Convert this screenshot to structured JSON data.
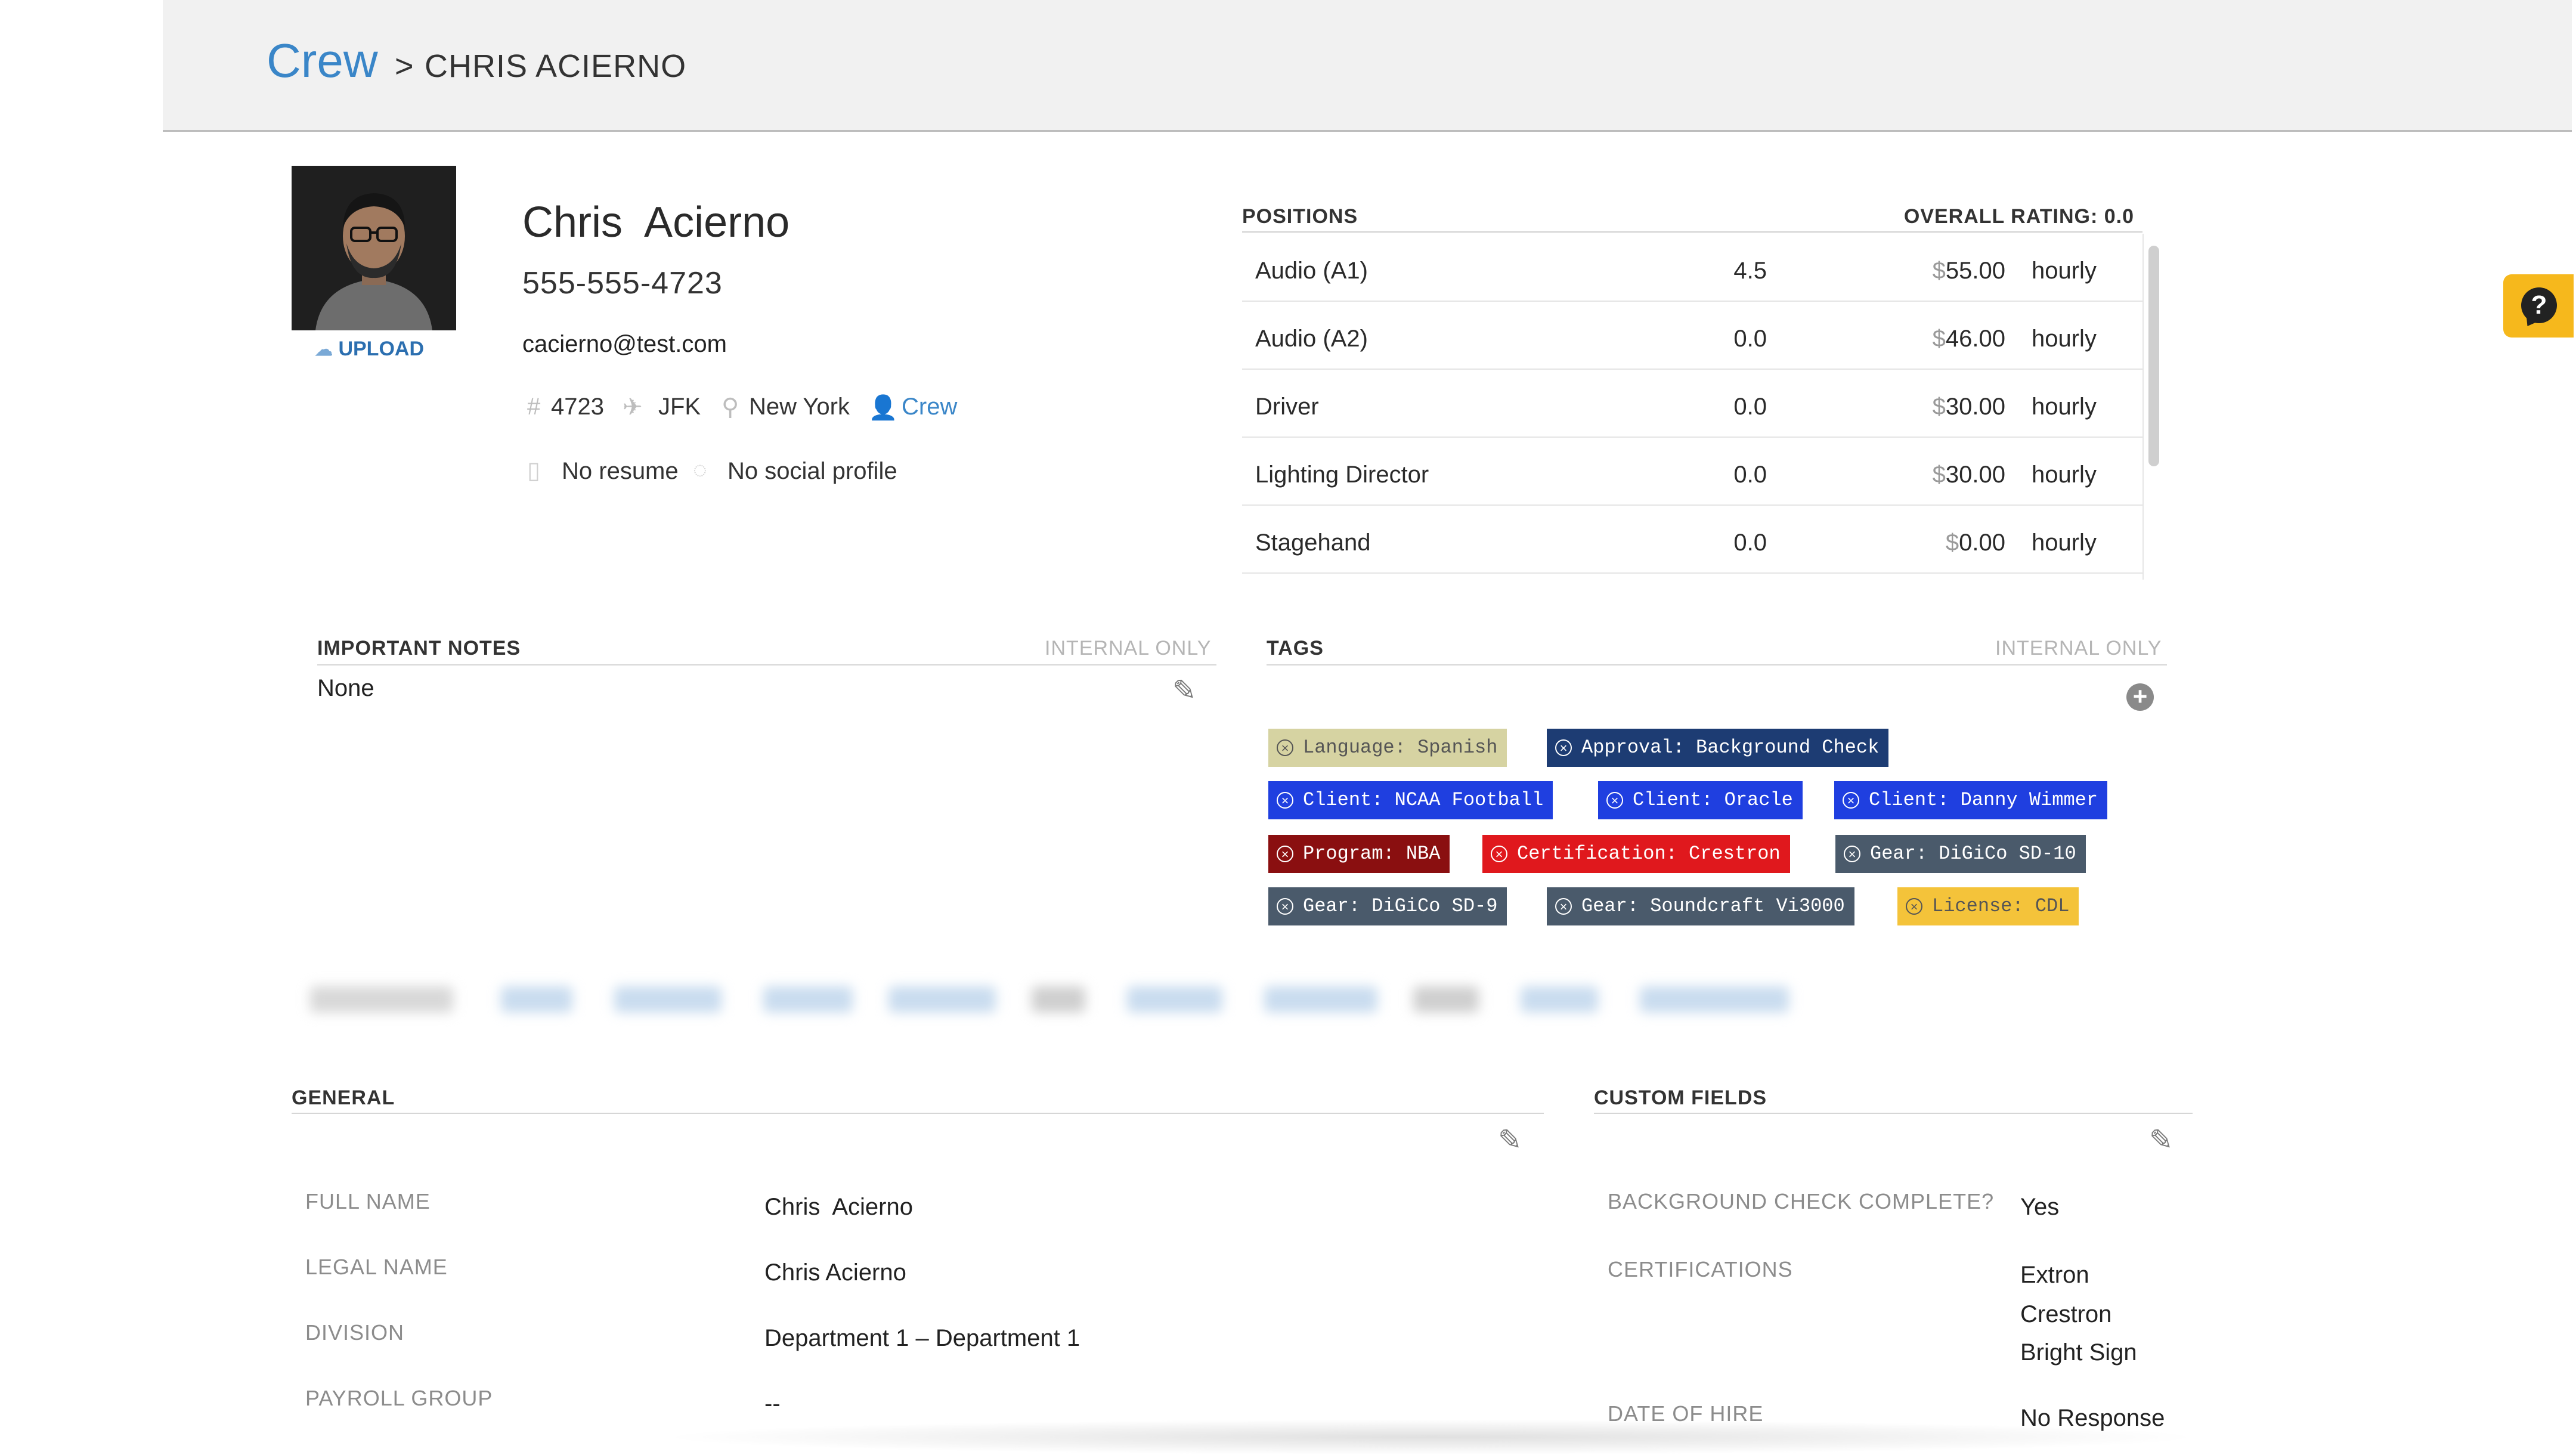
{
  "header": {
    "breadcrumb_root": "Crew",
    "breadcrumb_sep": ">",
    "breadcrumb_current": "CHRIS ACIERNO"
  },
  "help": {
    "icon": "help-chat-icon",
    "label": "?"
  },
  "profile": {
    "upload_label": "UPLOAD",
    "name": "Chris  Acierno",
    "phone": "555-555-4723",
    "email": "cacierno@test.com",
    "id_number": "4723",
    "airport": "JFK",
    "location": "New York",
    "group": "Crew",
    "resume": "No resume",
    "social": "No social profile"
  },
  "positions": {
    "title": "POSITIONS",
    "overall_rating": "OVERALL RATING: 0.0",
    "rows": [
      {
        "name": "Audio (A1)",
        "rating": "4.5",
        "pay": "55.00",
        "unit": "hourly"
      },
      {
        "name": "Audio (A2)",
        "rating": "0.0",
        "pay": "46.00",
        "unit": "hourly"
      },
      {
        "name": "Driver",
        "rating": "0.0",
        "pay": "30.00",
        "unit": "hourly"
      },
      {
        "name": "Lighting Director",
        "rating": "0.0",
        "pay": "30.00",
        "unit": "hourly"
      },
      {
        "name": "Stagehand",
        "rating": "0.0",
        "pay": "0.00",
        "unit": "hourly"
      }
    ],
    "currency_symbol": "$"
  },
  "notes": {
    "title": "IMPORTANT NOTES",
    "internal": "INTERNAL ONLY",
    "value": "None"
  },
  "tags": {
    "title": "TAGS",
    "internal": "INTERNAL ONLY",
    "items": [
      {
        "label": "Language: Spanish",
        "bg": "#d6d3a2",
        "fg": "#555555"
      },
      {
        "label": "Approval: Background Check",
        "bg": "#1d3c73",
        "fg": "#ffffff"
      },
      {
        "label": "Client: NCAA Football",
        "bg": "#1f3fe0",
        "fg": "#ffffff"
      },
      {
        "label": "Client: Oracle",
        "bg": "#1f3fe0",
        "fg": "#ffffff"
      },
      {
        "label": "Client: Danny Wimmer",
        "bg": "#1f3fe0",
        "fg": "#ffffff"
      },
      {
        "label": "Program: NBA",
        "bg": "#8a0f10",
        "fg": "#ffffff"
      },
      {
        "label": "Certification: Crestron",
        "bg": "#e0181d",
        "fg": "#ffffff"
      },
      {
        "label": "Gear: DiGiCo SD-10",
        "bg": "#4a5a6b",
        "fg": "#ffffff"
      },
      {
        "label": "Gear: DiGiCo SD-9",
        "bg": "#4a5a6b",
        "fg": "#ffffff"
      },
      {
        "label": "Gear: Soundcraft Vi3000",
        "bg": "#4a5a6b",
        "fg": "#ffffff"
      },
      {
        "label": "License: CDL",
        "bg": "#f4c33a",
        "fg": "#555555"
      }
    ]
  },
  "general": {
    "title": "GENERAL",
    "fields": [
      {
        "label": "FULL NAME",
        "value": "Chris  Acierno"
      },
      {
        "label": "LEGAL NAME",
        "value": "Chris Acierno"
      },
      {
        "label": "DIVISION",
        "value": "Department 1 – Department 1"
      },
      {
        "label": "PAYROLL GROUP",
        "value": "--"
      }
    ]
  },
  "custom": {
    "title": "CUSTOM FIELDS",
    "fields": [
      {
        "label": "BACKGROUND CHECK COMPLETE?",
        "values": [
          "Yes"
        ]
      },
      {
        "label": "CERTIFICATIONS",
        "values": [
          "Extron",
          "Crestron",
          "Bright Sign"
        ]
      },
      {
        "label": "DATE OF HIRE",
        "values": [
          "No Response"
        ]
      }
    ]
  }
}
